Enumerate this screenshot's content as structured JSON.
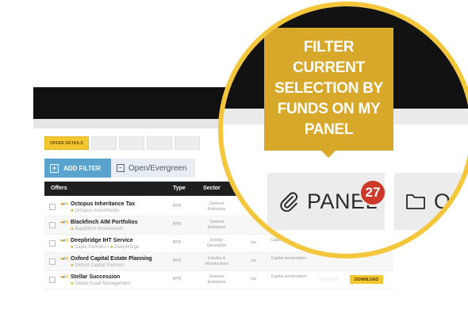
{
  "tabs": {
    "offer_details": "OFFER DETAILS"
  },
  "filter": {
    "add_label": "ADD FILTER",
    "open_label": "Open/Evergreen"
  },
  "table": {
    "headers": {
      "offers": "Offers",
      "type": "Type",
      "sector": "Sector"
    },
    "rows": [
      {
        "name": "Octopus Inheritance Tax",
        "manager": "Octopus Investments",
        "type": "BPR",
        "sector": "General Enterprise",
        "na": "",
        "objective": "",
        "stars": "",
        "download": ""
      },
      {
        "name": "Blackfinch AIM Portfolios",
        "manager": "Blackfinch Investments",
        "type": "BPR",
        "sector": "General Enterprise",
        "na": "",
        "objective": "",
        "stars": "",
        "download": ""
      },
      {
        "name": "Deepbridge IHT Service",
        "manager": "Sapia Partners / ",
        "manager2": "Deepbridge",
        "type": "BPR",
        "sector": "Energy Generation",
        "na": "n/a",
        "objective": "Capital preservation",
        "stars": "",
        "download": ""
      },
      {
        "name": "Oxford Capital Estate Planning",
        "manager": "Oxford Capital Partners",
        "type": "BPR",
        "sector": "Industry & Infrastructure",
        "na": "n/a",
        "objective": "Capital preservation",
        "stars": "",
        "download": ""
      },
      {
        "name": "Stellar Succession",
        "manager": "Stellar Asset Management",
        "type": "BPR",
        "sector": "General Enterprise",
        "na": "n/a",
        "objective": "Capital preservation",
        "stars": "☆☆☆☆☆",
        "download": "DOWNLOAD"
      }
    ]
  },
  "lens": {
    "tooltip_lines": [
      "FILTER",
      "CURRENT",
      "SELECTION BY",
      "FUNDS ON MY",
      "PANEL"
    ],
    "panel_label": "PANEL",
    "panel_count": "27",
    "open_label": "OP"
  },
  "colors": {
    "accent": "#f4c630",
    "tooltip": "#d7a829",
    "badge": "#cd3a2a",
    "filter_blue": "#5aa3cf"
  },
  "icons": {
    "panel": "paperclip-icon",
    "open": "folder-icon"
  }
}
